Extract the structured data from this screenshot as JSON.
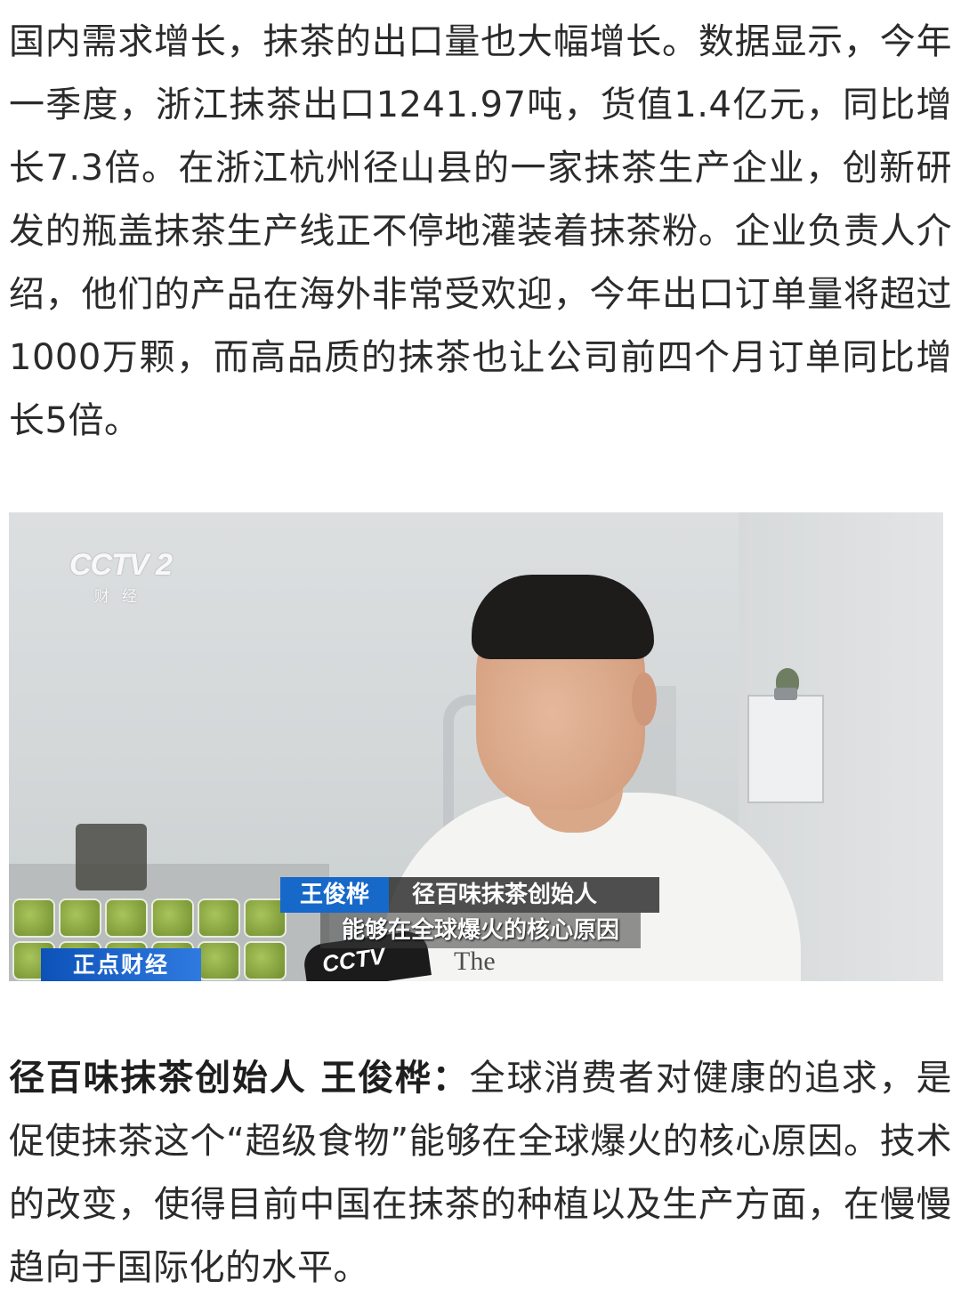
{
  "article": {
    "paragraph_1": "国内需求增长，抹茶的出口量也大幅增长。数据显示，今年一季度，浙江抹茶出口1241.97吨，货值1.4亿元，同比增长7.3倍。在浙江杭州径山县的一家抹茶生产企业，创新研发的瓶盖抹茶生产线正不停地灌装着抹茶粉。企业负责人介绍，他们的产品在海外非常受欢迎，今年出口订单量将超过1000万颗，而高品质的抹茶也让公司前四个月订单同比增长5倍。",
    "quote_speaker": "径百味抹茶创始人 王俊桦：",
    "quote_text": "全球消费者对健康的追求，是促使抹茶这个“超级食物”能够在全球爆火的核心原因。技术的改变，使得目前中国在抹茶的种植以及生产方面，在慢慢趋向于国际化的水平。"
  },
  "video_frame": {
    "channel_logo": "CCTV 2",
    "channel_sub": "财经",
    "name_tag": "王俊桦",
    "title_tag": "径百味抹茶创始人",
    "subtitle": "能够在全球爆火的核心原因",
    "program_tag": "正点财经",
    "mic_logo": "CCTV",
    "shirt_print": "The"
  },
  "colors": {
    "name_tag_bg": "#1668c9",
    "program_tag_bg": "#0c52b8",
    "text": "#2b2b2b"
  }
}
